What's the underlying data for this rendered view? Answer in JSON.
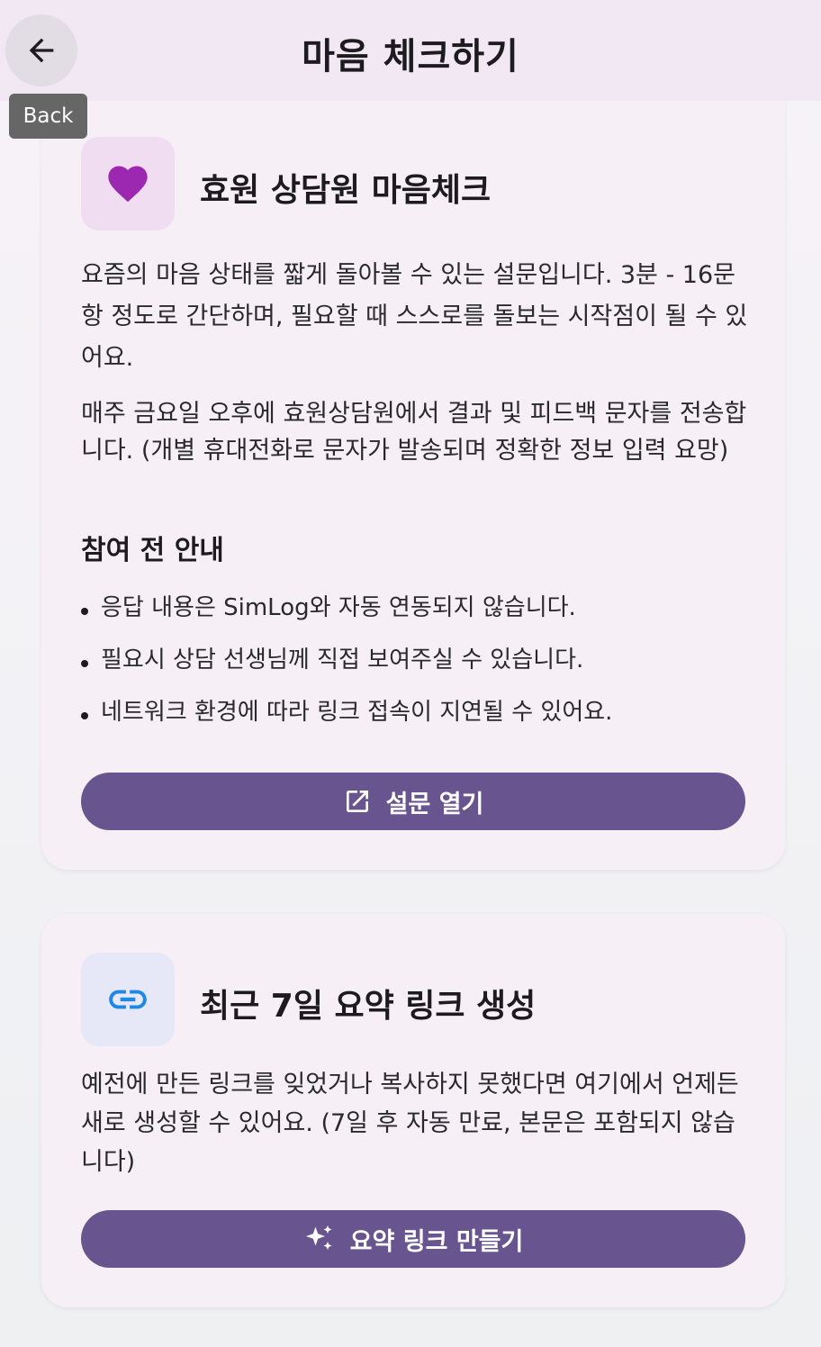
{
  "appbar": {
    "title": "마음 체크하기",
    "back_tooltip": "Back"
  },
  "colors": {
    "primary": "#68548e",
    "heart": "#9c27b0",
    "link_icon": "#1e88e5",
    "card_bg": "#f7eff6",
    "appbar_bg": "#f1e8f4"
  },
  "survey_card": {
    "icon": "heart-icon",
    "title": "효원 상담원 마음체크",
    "description1": "요즘의 마음 상태를 짧게 돌아볼 수 있는 설문입니다. 3분 - 16문항 정도로 간단하며, 필요할 때 스스로를 돌보는 시작점이 될 수 있어요.",
    "description2": "매주 금요일 오후에 효원상담원에서 결과 및 피드백 문자를 전송합니다. (개별 휴대전화로 문자가 발송되며 정확한 정보 입력 요망)",
    "guide_title": "참여 전 안내",
    "guide_items": [
      "응답 내용은 SimLog와 자동 연동되지 않습니다.",
      "필요시 상담 선생님께 직접 보여주실 수 있습니다.",
      "네트워크 환경에 따라 링크 접속이 지연될 수 있어요."
    ],
    "button_label": "설문 열기",
    "button_icon": "open-in-new-icon"
  },
  "summary_card": {
    "icon": "link-icon",
    "title": "최근 7일 요약 링크 생성",
    "description": "예전에 만든 링크를 잊었거나 복사하지 못했다면 여기에서 언제든 새로 생성할 수 있어요. (7일 후 자동 만료, 본문은 포함되지 않습니다)",
    "button_label": "요약 링크 만들기",
    "button_icon": "sparkle-icon"
  }
}
